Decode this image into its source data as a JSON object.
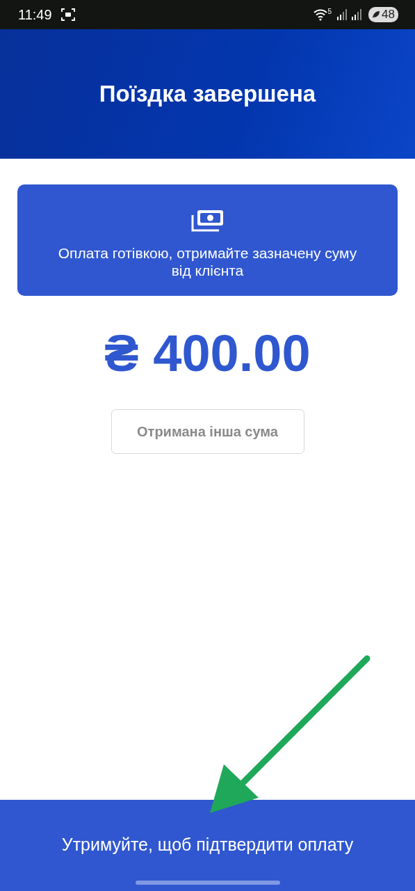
{
  "status_bar": {
    "time": "11:49",
    "wifi_badge": "5",
    "battery": "48"
  },
  "header": {
    "title": "Поїздка завершена"
  },
  "payment_card": {
    "message": "Оплата готівкою, отримайте зазначену суму від клієнта"
  },
  "amount": "₴ 400.00",
  "other_amount_button": "Отримана інша сума",
  "confirm_bar": {
    "label": "Утримуйте, щоб підтвердити оплату"
  }
}
